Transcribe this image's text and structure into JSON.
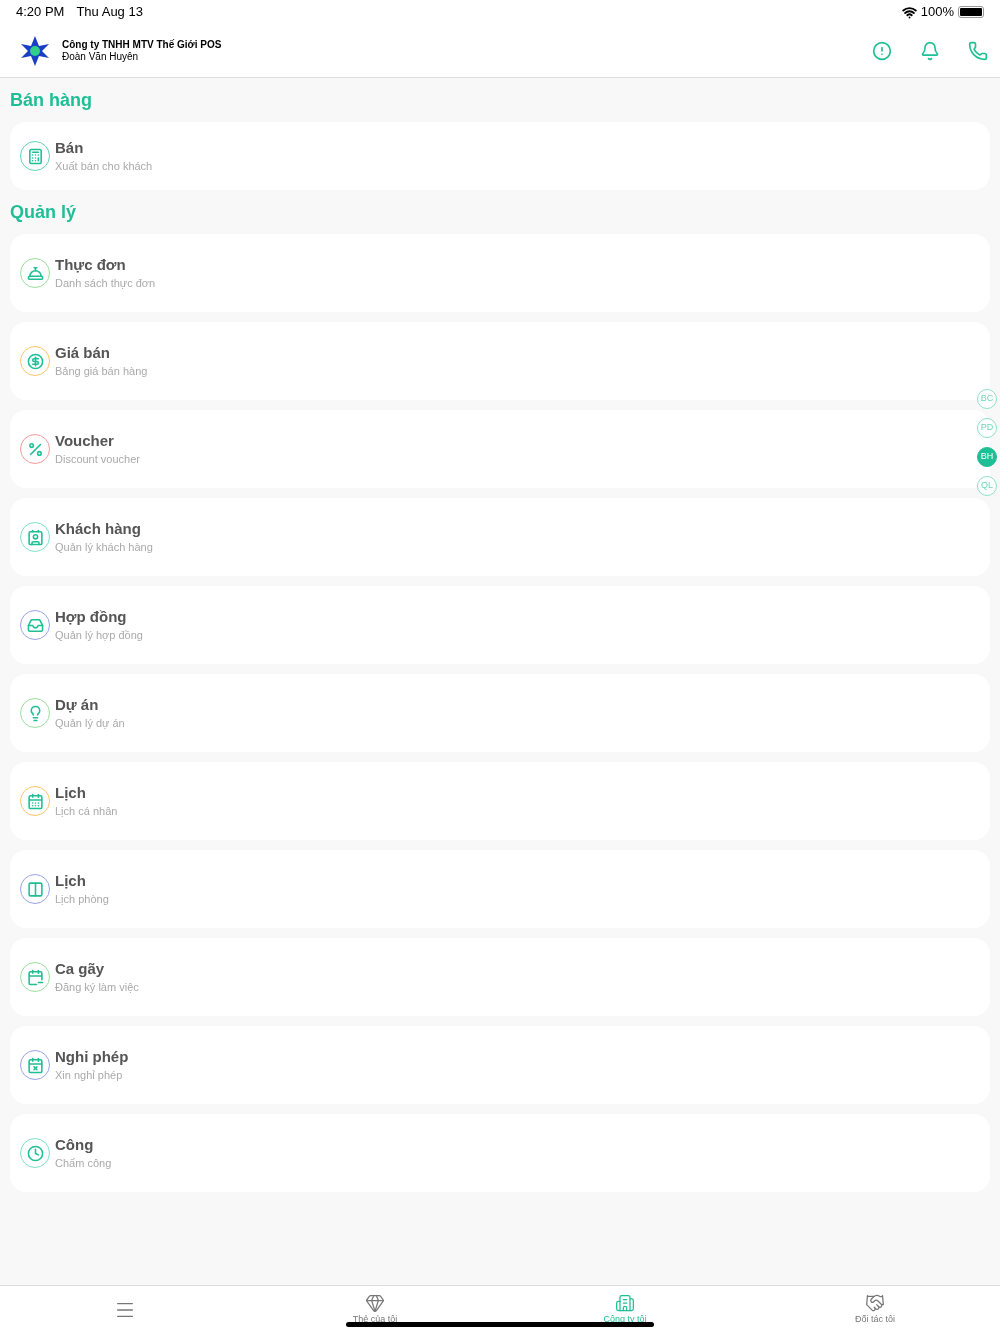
{
  "status_bar": {
    "time": "4:20 PM",
    "date": "Thu Aug 13",
    "battery": "100%"
  },
  "header": {
    "company": "Công ty TNHH MTV Thế Giới POS",
    "user": "Đoàn Văn Huyên"
  },
  "sections": [
    {
      "title": "Bán hàng",
      "items": [
        {
          "kind": "register",
          "color": "#5fd4b4",
          "title": "Bán",
          "subtitle": "Xuất bán cho khách"
        }
      ]
    },
    {
      "title": "Quản lý",
      "items": [
        {
          "kind": "bell",
          "color": "#9ddf9f",
          "title": "Thực đơn",
          "subtitle": "Danh sách thực đơn"
        },
        {
          "kind": "money",
          "color": "#ffc46b",
          "title": "Giá bán",
          "subtitle": "Bảng giá bán hàng"
        },
        {
          "kind": "percent",
          "color": "#f29a9a",
          "title": "Voucher",
          "subtitle": "Discount voucher"
        },
        {
          "kind": "contact",
          "color": "#7fe0c8",
          "title": "Khách hàng",
          "subtitle": "Quản lý khách hàng"
        },
        {
          "kind": "inbox",
          "color": "#9aa4e8",
          "title": "Hợp đồng",
          "subtitle": "Quản lý hợp đồng"
        },
        {
          "kind": "bulb",
          "color": "#9ddf9f",
          "title": "Dự án",
          "subtitle": "Quản lý dự án"
        },
        {
          "kind": "calendar",
          "color": "#ffc46b",
          "title": "Lịch",
          "subtitle": "Lịch cá nhân"
        },
        {
          "kind": "board",
          "color": "#9aa4e8",
          "title": "Lịch",
          "subtitle": "Lịch phòng"
        },
        {
          "kind": "shift",
          "color": "#9ddf9f",
          "title": "Ca gãy",
          "subtitle": "Đăng ký làm việc"
        },
        {
          "kind": "leave",
          "color": "#9aa4e8",
          "title": "Nghỉ phép",
          "subtitle": "Xin nghỉ phép"
        },
        {
          "kind": "clock",
          "color": "#7fe0c8",
          "title": "Công",
          "subtitle": "Chấm công"
        }
      ]
    }
  ],
  "index": [
    {
      "label": "BC",
      "selected": false
    },
    {
      "label": "PD",
      "selected": false
    },
    {
      "label": "BH",
      "selected": true
    },
    {
      "label": "QL",
      "selected": false
    }
  ],
  "tabs": [
    {
      "kind": "menu",
      "selected": false
    },
    {
      "kind": "diamond",
      "label": "Thẻ của tôi",
      "selected": false
    },
    {
      "kind": "building",
      "label": "Công ty tôi",
      "selected": true
    },
    {
      "kind": "handshake",
      "label": "Đối tác tôi",
      "selected": false
    }
  ]
}
